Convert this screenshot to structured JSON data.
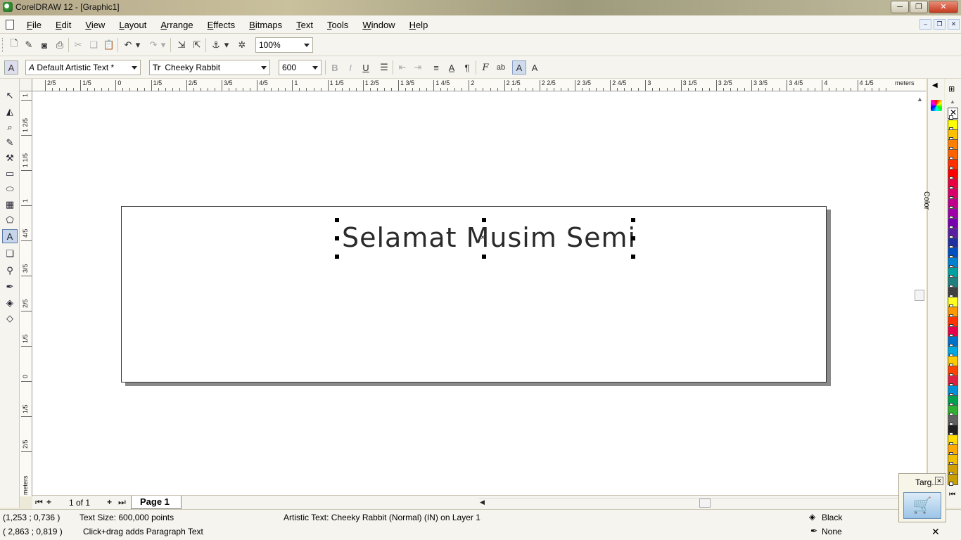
{
  "window": {
    "title": "CorelDRAW 12 - [Graphic1]",
    "minimize": "─",
    "maximize": "❐",
    "close": "✕"
  },
  "menu": [
    "File",
    "Edit",
    "View",
    "Layout",
    "Arrange",
    "Effects",
    "Bitmaps",
    "Text",
    "Tools",
    "Window",
    "Help"
  ],
  "mdi": {
    "minimize": "–",
    "restore": "❐",
    "close": "✕"
  },
  "standard_toolbar": {
    "zoom": "100%"
  },
  "property_bar": {
    "text_style": "Default Artistic Text *",
    "font": "Cheeky Rabbit",
    "font_size": "600",
    "font_lead": "Tr"
  },
  "rulers": {
    "h_labels": [
      "2/5",
      "1/5",
      "0",
      "1/5",
      "2/5",
      "3/5",
      "4/5",
      "1",
      "1 1/5",
      "1 2/5",
      "1 3/5",
      "1 4/5",
      "2",
      "2 1/5",
      "2 2/5",
      "2 3/5",
      "2 4/5",
      "3",
      "3 1/5",
      "3 2/5",
      "3 3/5",
      "3 4/5",
      "4",
      "4 1/5"
    ],
    "h_unit": "meters",
    "v_labels": [
      "1 3/5",
      "1 2/5",
      "1 1/5",
      "1",
      "4/5",
      "3/5",
      "2/5",
      "1/5",
      "0",
      "1/5",
      "2/5"
    ],
    "v_unit": "meters"
  },
  "canvas": {
    "text": "Selamat Musim Semi"
  },
  "page_nav": {
    "count": "1 of 1",
    "tab": "Page 1"
  },
  "status": {
    "cursor_pos": "(1,253 ; 0,736 )",
    "text_size": "Text Size: 600,000 points",
    "object_info": "Artistic Text: Cheeky Rabbit (Normal) (IN) on Layer 1",
    "fill": "Black",
    "outline": "None",
    "cursor_pos2": "( 2,863 ; 0,819 )",
    "hint": "Click+drag adds Paragraph Text"
  },
  "docker": {
    "label": "Color"
  },
  "target": {
    "label": "Targ..."
  },
  "palette": [
    "#ffff00",
    "#ffc000",
    "#ff8000",
    "#ff6000",
    "#ff3000",
    "#ff0000",
    "#e80040",
    "#d8006a",
    "#c0008c",
    "#a000a8",
    "#7800b0",
    "#5a1ea0",
    "#2030a0",
    "#0050c0",
    "#0080d0",
    "#00a0a0",
    "#208080",
    "#404040",
    "#ffff20",
    "#ff9900",
    "#ff3300",
    "#e8004a",
    "#0070c8",
    "#00a8e0",
    "#ffcc00",
    "#ff4400",
    "#e02040",
    "#0090d8",
    "#00a050",
    "#30b030",
    "#606060",
    "#202020",
    "#ffdd00",
    "#ffaa00",
    "#f0c000",
    "#d0a000",
    "#c8a000"
  ],
  "colors": {
    "accent": "#c6d5ea",
    "page_shadow": "#8a8a8a"
  }
}
